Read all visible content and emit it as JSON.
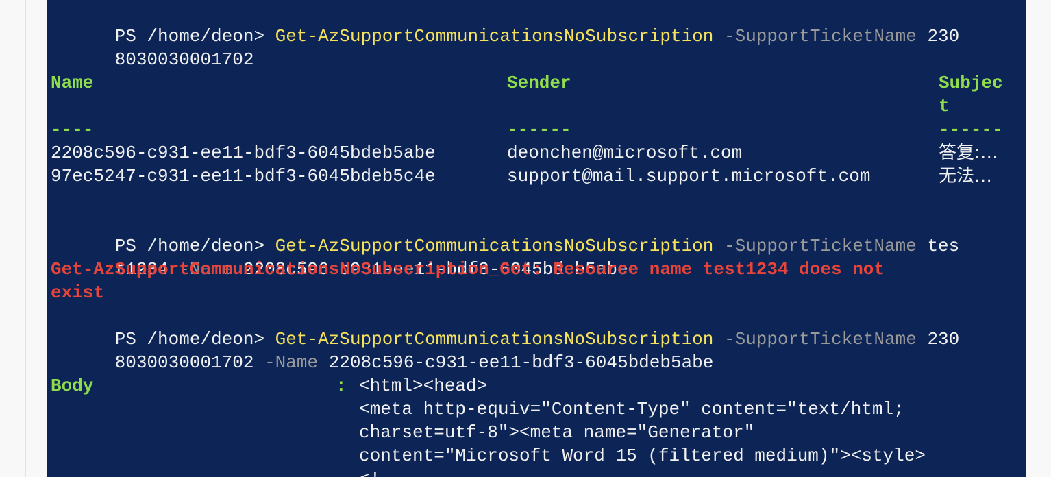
{
  "terminal": {
    "prompt": "PS /home/deon> ",
    "command1": {
      "cmd": "Get-AzSupportCommunicationsNoSubscription",
      "param1": " -SupportTicketName",
      "arg1_part1": " 230",
      "arg1_part2": "8030030001702"
    },
    "table": {
      "headers": {
        "name": "Name",
        "sender": "Sender",
        "subject_part1": "Subjec",
        "subject_part2": "t"
      },
      "underlines": {
        "name": "----",
        "sender": "------",
        "subject": "------"
      },
      "rows": [
        {
          "name": "2208c596-c931-ee11-bdf3-6045bdeb5abe",
          "sender": "deonchen@microsoft.com",
          "subject": "答复:…"
        },
        {
          "name": "97ec5247-c931-ee11-bdf3-6045bdeb5c4e",
          "sender": "support@mail.support.microsoft.com",
          "subject": "无法…"
        }
      ]
    },
    "command2": {
      "cmd": "Get-AzSupportCommunicationsNoSubscription",
      "param1": " -SupportTicketName",
      "arg1_part1": " tes",
      "arg1_part2": "t1234",
      "param2": " -Name",
      "arg2": " 2208c596-c931-ee11-bdf3-6045bdeb5abe"
    },
    "error": {
      "line1": "Get-AzSupportCommunicationsNoSubscription_Get: Resource name test1234 does not",
      "line2": "exist"
    },
    "command3": {
      "cmd": "Get-AzSupportCommunicationsNoSubscription",
      "param1": " -SupportTicketName",
      "arg1_part1": " 230",
      "arg1_part2": "8030030001702",
      "param2": " -Name",
      "arg2": " 2208c596-c931-ee11-bdf3-6045bdeb5abe"
    },
    "body": {
      "label": "Body",
      "separator": ":",
      "lines": [
        "<html><head>",
        "<meta http-equiv=\"Content-Type\" content=\"text/html;",
        "charset=utf-8\"><meta name=\"Generator\"",
        "content=\"Microsoft Word 15 (filtered medium)\"><style>",
        "<!--"
      ]
    }
  }
}
